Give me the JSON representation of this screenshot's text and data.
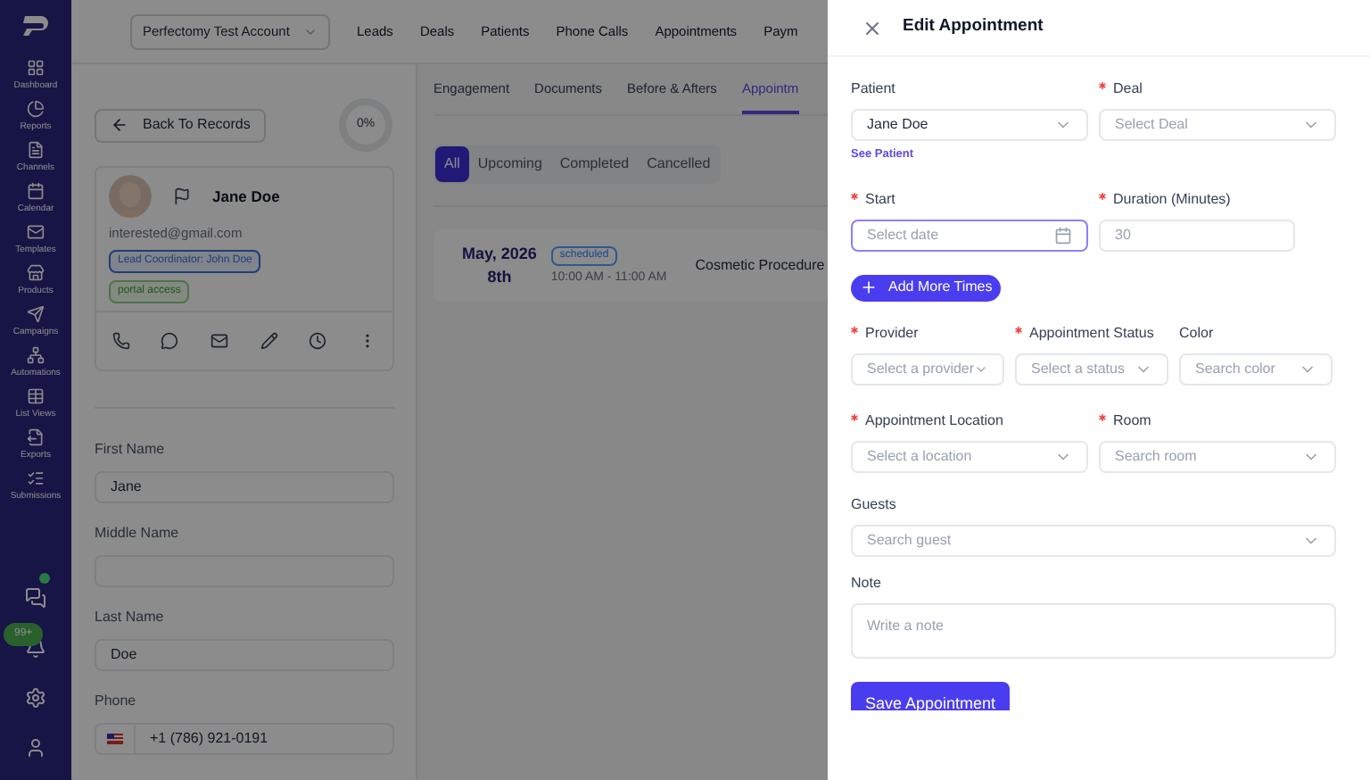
{
  "sidebar": {
    "items": [
      {
        "label": "Dashboard"
      },
      {
        "label": "Reports"
      },
      {
        "label": "Channels"
      },
      {
        "label": "Calendar"
      },
      {
        "label": "Templates"
      },
      {
        "label": "Products"
      },
      {
        "label": "Campaigns"
      },
      {
        "label": "Automations"
      },
      {
        "label": "List Views"
      },
      {
        "label": "Exports"
      },
      {
        "label": "Submissions"
      }
    ],
    "notifications_badge": "99+"
  },
  "top_bar": {
    "account": "Perfectomy Test Account",
    "nav": [
      "Leads",
      "Deals",
      "Patients",
      "Phone Calls",
      "Appointments",
      "Paym"
    ]
  },
  "record": {
    "back_button": "Back To Records",
    "progress": "0%",
    "name": "Jane Doe",
    "email": "interested@gmail.com",
    "badges": [
      {
        "label": "Lead Coordinator: John Doe",
        "kind": "info"
      },
      {
        "label": "portal access",
        "kind": "success"
      }
    ],
    "fields": [
      {
        "label": "First Name",
        "kind": "text",
        "value": "Jane"
      },
      {
        "label": "Middle Name",
        "kind": "text"
      },
      {
        "label": "Last Name",
        "kind": "text",
        "value": "Doe"
      },
      {
        "label": "Phone",
        "kind": "phone",
        "value": "+1 (786) 921-0191"
      }
    ]
  },
  "record_tabs": [
    {
      "label": "Engagement",
      "selected": false
    },
    {
      "label": "Documents",
      "selected": false
    },
    {
      "label": "Before & Afters",
      "selected": false
    },
    {
      "label": "Appointm",
      "selected": true
    }
  ],
  "filters": [
    {
      "label": "All",
      "selected": true
    },
    {
      "label": "Upcoming",
      "selected": false
    },
    {
      "label": "Completed",
      "selected": false
    },
    {
      "label": "Cancelled",
      "selected": false
    }
  ],
  "appointment": {
    "month": "May, 2026",
    "day": "8th",
    "status": "scheduled",
    "time": "10:00 AM - 11:00 AM",
    "title": "Cosmetic Procedure"
  },
  "drawer": {
    "title": "Edit Appointment",
    "link": "See Patient",
    "add_button": "Add More Times",
    "save_button": "Save Appointment",
    "rows": [
      [
        {
          "label": "Patient",
          "required": false,
          "kind": "select",
          "value": "Jane Doe"
        },
        {
          "label": "Deal",
          "required": true,
          "kind": "select",
          "placeholder": "Select Deal"
        }
      ],
      [
        {
          "label": "Start",
          "required": true,
          "kind": "date",
          "placeholder": "Select date",
          "focused": true
        },
        {
          "label": "Duration (Minutes)",
          "required": true,
          "kind": "number",
          "placeholder": "30",
          "focused": false
        }
      ],
      [
        {
          "label": "Provider",
          "required": true,
          "kind": "select",
          "placeholder": "Select a provider"
        },
        {
          "label": "Appointment Status",
          "required": true,
          "kind": "select",
          "placeholder": "Select a status"
        },
        {
          "label": "Color",
          "required": false,
          "kind": "select",
          "placeholder": "Search color"
        }
      ],
      [
        {
          "label": "Appointment Location",
          "required": true,
          "kind": "select",
          "placeholder": "Select a location"
        },
        {
          "label": "Room",
          "required": true,
          "kind": "select",
          "placeholder": "Search room"
        }
      ],
      [
        {
          "label": "Guests",
          "required": false,
          "kind": "select",
          "placeholder": "Search guest"
        }
      ],
      [
        {
          "label": "Note",
          "required": false,
          "kind": "textarea",
          "placeholder": "Write a note"
        }
      ]
    ]
  }
}
